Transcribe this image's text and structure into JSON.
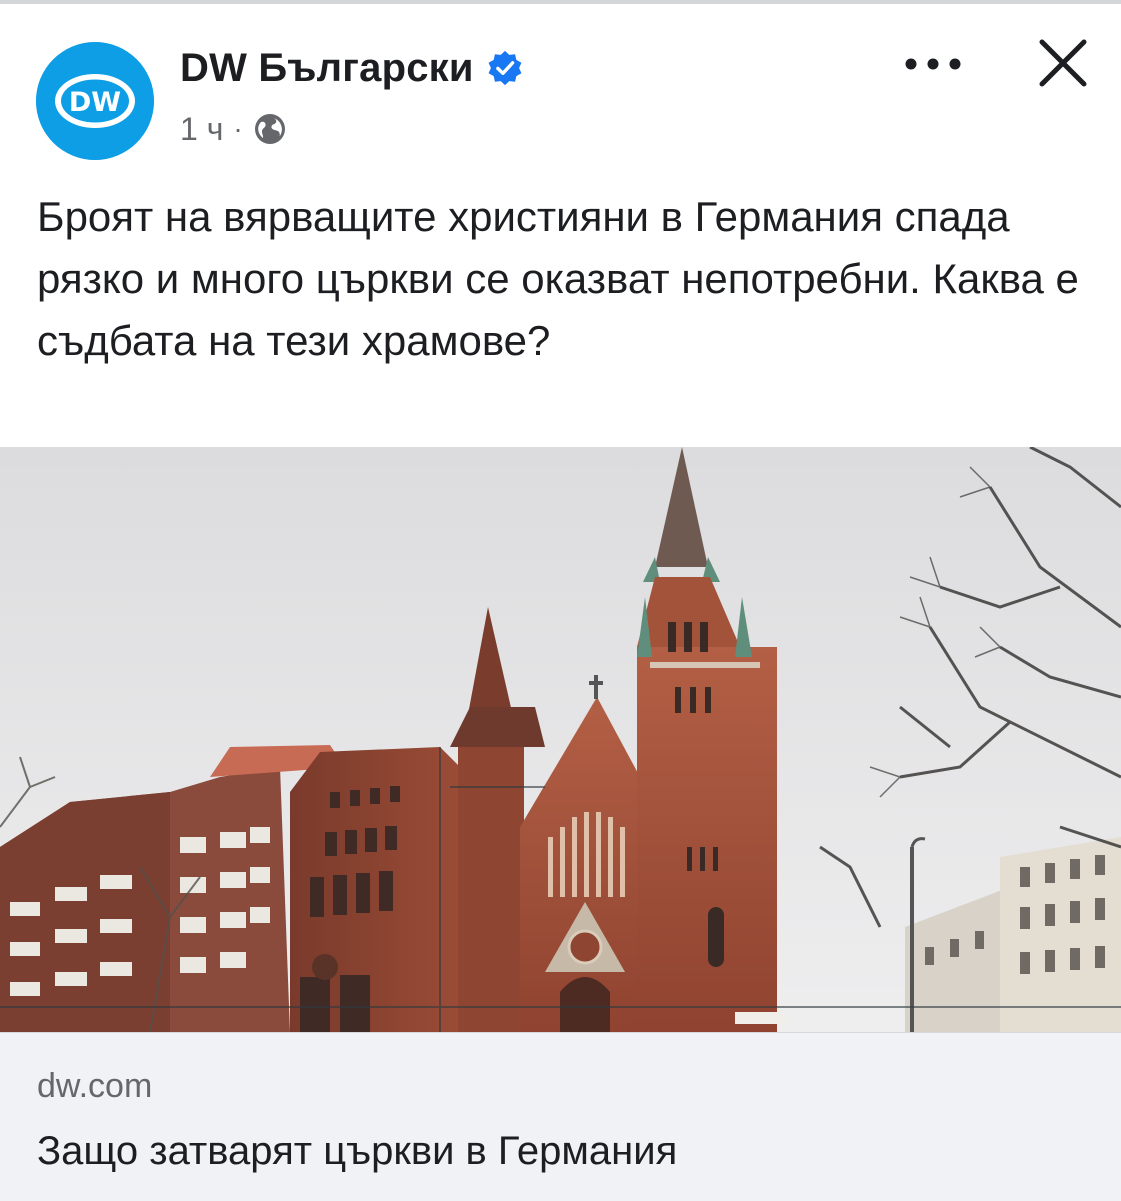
{
  "post": {
    "page_name": "DW Български",
    "time": "1 ч",
    "separator": "·",
    "text": "Броят на вярващите християни в Германия спада рязко и много църкви се оказват непотребни. Каква е съдбата на тези храмове?",
    "avatar": {
      "logo_text": "DW",
      "color": "#0e9ee6"
    },
    "icons": {
      "verified": "verified-badge-icon",
      "audience": "globe-icon",
      "more": "more-dots-icon",
      "close": "close-icon"
    }
  },
  "link_preview": {
    "domain": "dw.com",
    "title": "Защо затварят църкви в Германия"
  },
  "colors": {
    "accent_blue": "#1877f2",
    "secondary_text": "#65676b",
    "card_background": "#f0f2f5"
  }
}
